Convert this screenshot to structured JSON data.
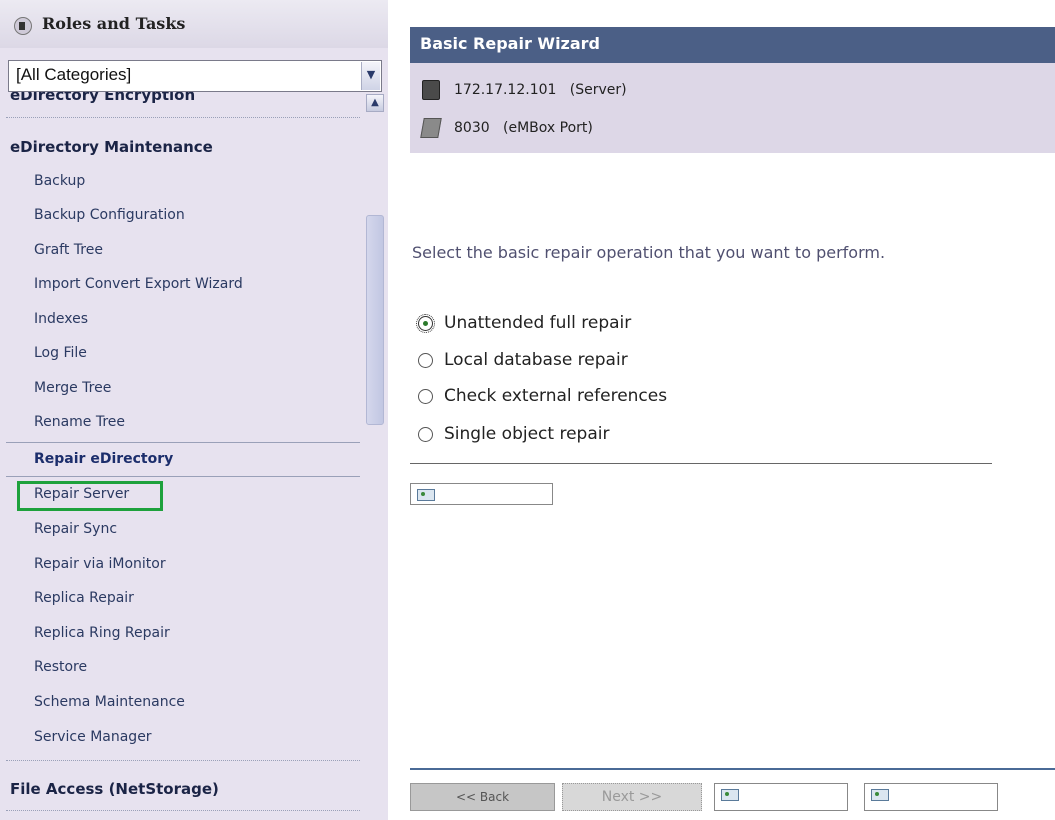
{
  "sidebar": {
    "title": "Roles and Tasks",
    "category_select": {
      "value": "[All Categories]"
    },
    "items": [
      {
        "label": "eDirectory Encryption",
        "kind": "category"
      },
      {
        "label": "eDirectory Maintenance",
        "kind": "category"
      },
      {
        "label": "Backup",
        "kind": "task"
      },
      {
        "label": "Backup Configuration",
        "kind": "task"
      },
      {
        "label": "Graft Tree",
        "kind": "task"
      },
      {
        "label": "Import Convert Export Wizard",
        "kind": "task"
      },
      {
        "label": "Indexes",
        "kind": "task"
      },
      {
        "label": "Log File",
        "kind": "task"
      },
      {
        "label": "Merge Tree",
        "kind": "task"
      },
      {
        "label": "Rename Tree",
        "kind": "task"
      },
      {
        "label": "Repair eDirectory",
        "kind": "subgroup"
      },
      {
        "label": "Repair Server",
        "kind": "task",
        "highlighted": true
      },
      {
        "label": "Repair Sync",
        "kind": "task"
      },
      {
        "label": "Repair via iMonitor",
        "kind": "task"
      },
      {
        "label": "Replica Repair",
        "kind": "task"
      },
      {
        "label": "Replica Ring Repair",
        "kind": "task"
      },
      {
        "label": "Restore",
        "kind": "task"
      },
      {
        "label": "Schema Maintenance",
        "kind": "task"
      },
      {
        "label": "Service Manager",
        "kind": "task"
      },
      {
        "label": "File Access (NetStorage)",
        "kind": "category"
      }
    ],
    "highlight_color": "#1ea13c"
  },
  "wizard": {
    "title": "Basic Repair Wizard",
    "server": {
      "address": "172.17.12.101",
      "type": "(Server)",
      "icon": "server-icon"
    },
    "port": {
      "number": "8030",
      "type": "(eMBox Port)",
      "icon": "port-icon"
    },
    "prompt": "Select the basic repair operation that you want to perform.",
    "options": [
      {
        "label": "Unattended full repair",
        "selected": true
      },
      {
        "label": "Local database repair",
        "selected": false
      },
      {
        "label": "Check external references",
        "selected": false
      },
      {
        "label": "Single object repair",
        "selected": false
      }
    ]
  },
  "footer": {
    "back_label": "<< Back",
    "next_label": "Next >>"
  },
  "colors": {
    "sidebar_bg": "#e7e2ef",
    "wizard_bar": "#4b5f86",
    "info_panel": "#ddd7e7"
  }
}
